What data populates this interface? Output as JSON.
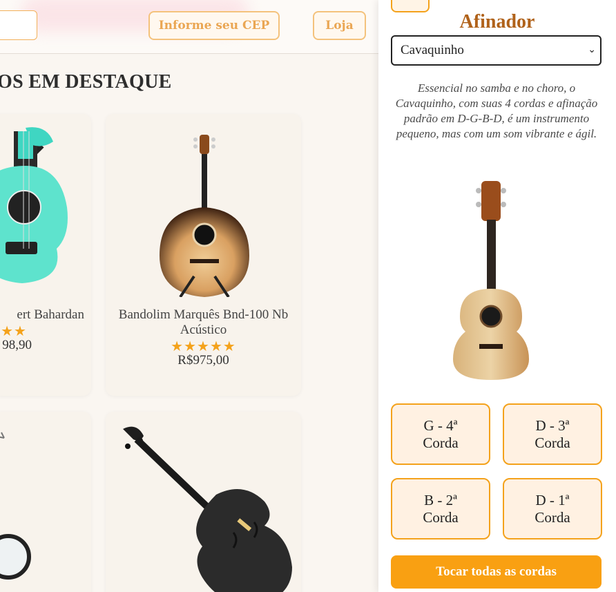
{
  "header": {
    "cep_button": "Informe seu CEP",
    "store_button": "Loja"
  },
  "section": {
    "title": "OS EM DESTAQUE"
  },
  "products": [
    {
      "name": "ert Bahardan",
      "stars": "★★",
      "price": "98,90"
    },
    {
      "name": "Bandolim Marquês Bnd-100 Nb Acústico",
      "stars": "★★★★★",
      "price": "R$975,00"
    }
  ],
  "tuner": {
    "title": "Afinador",
    "instrument_selected": "Cavaquinho",
    "description": "Essencial no samba e no choro, o Cavaquinho, com suas 4 cordas e afinação padrão em D-G-B-D, é um instrumento pequeno, mas com um som vibrante e ágil.",
    "strings": [
      {
        "note": "G - 4ª",
        "label": "Corda"
      },
      {
        "note": "D - 3ª",
        "label": "Corda"
      },
      {
        "note": "B - 2ª",
        "label": "Corda"
      },
      {
        "note": "D - 1ª",
        "label": "Corda"
      }
    ],
    "play_all_label": "Tocar todas as cordas"
  },
  "colors": {
    "accent": "#f9a012",
    "title": "#b0621a",
    "stars": "#f4a21b"
  }
}
